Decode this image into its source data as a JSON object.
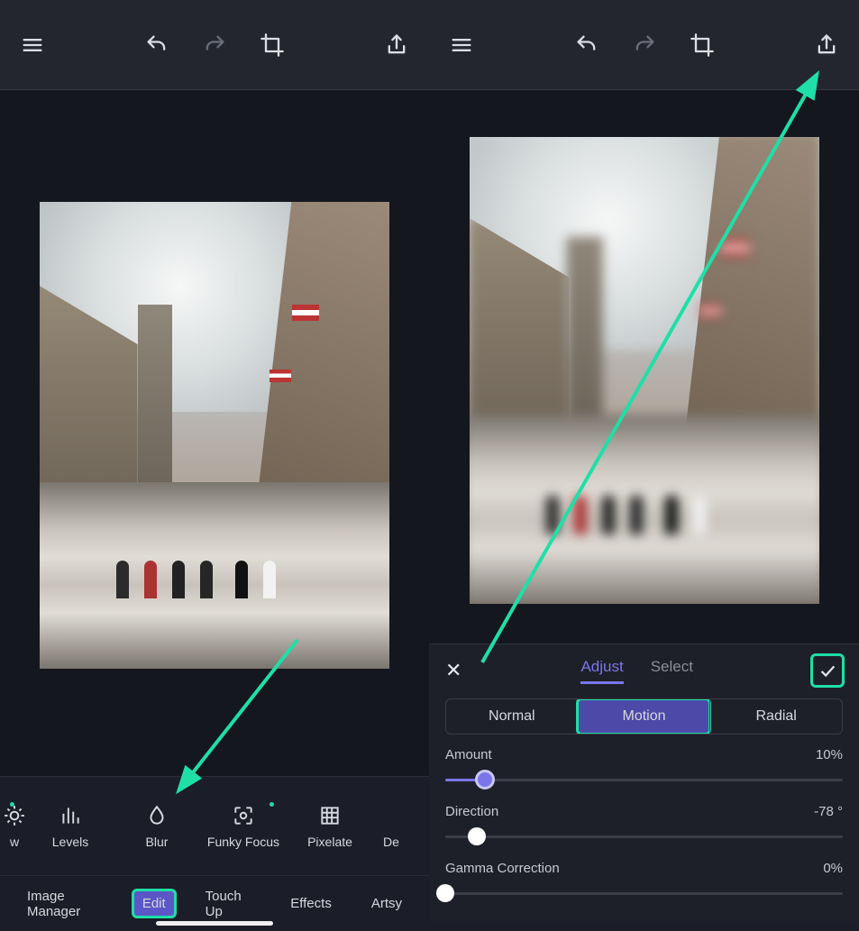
{
  "toolbar_icons": {
    "menu": "menu-icon",
    "undo": "undo-icon",
    "redo": "redo-icon",
    "crop": "crop-icon",
    "share": "share-icon"
  },
  "left": {
    "tools": [
      {
        "id": "w",
        "label": "w",
        "icon": "sun-icon",
        "has_dot": true,
        "partial": true
      },
      {
        "id": "levels",
        "label": "Levels",
        "icon": "bars-icon",
        "has_dot": false
      },
      {
        "id": "blur",
        "label": "Blur",
        "icon": "drop-icon",
        "has_dot": false
      },
      {
        "id": "funky",
        "label": "Funky Focus",
        "icon": "focus-icon",
        "has_dot": true
      },
      {
        "id": "pixelate",
        "label": "Pixelate",
        "icon": "grid-icon",
        "has_dot": false
      },
      {
        "id": "de",
        "label": "De",
        "icon": "blank-icon",
        "has_dot": false,
        "partial": true
      }
    ],
    "categories": [
      {
        "id": "image-manager",
        "label": "Image Manager",
        "active": false
      },
      {
        "id": "edit",
        "label": "Edit",
        "active": true,
        "highlight": true
      },
      {
        "id": "touchup",
        "label": "Touch Up",
        "active": false
      },
      {
        "id": "effects",
        "label": "Effects",
        "active": false
      },
      {
        "id": "artsy",
        "label": "Artsy",
        "active": false
      }
    ]
  },
  "right": {
    "tabs": [
      {
        "id": "adjust",
        "label": "Adjust",
        "active": true
      },
      {
        "id": "select",
        "label": "Select",
        "active": false
      }
    ],
    "blur_modes": [
      {
        "id": "normal",
        "label": "Normal",
        "active": false
      },
      {
        "id": "motion",
        "label": "Motion",
        "active": true,
        "highlight": true
      },
      {
        "id": "radial",
        "label": "Radial",
        "active": false
      }
    ],
    "sliders": {
      "amount": {
        "label": "Amount",
        "value_text": "10%",
        "percent": 10
      },
      "direction": {
        "label": "Direction",
        "value_text": "-78 °",
        "percent": 8
      },
      "gamma": {
        "label": "Gamma Correction",
        "value_text": "0%",
        "percent": 0
      }
    }
  },
  "annotations": {
    "highlight_color": "#1fdfa7"
  }
}
